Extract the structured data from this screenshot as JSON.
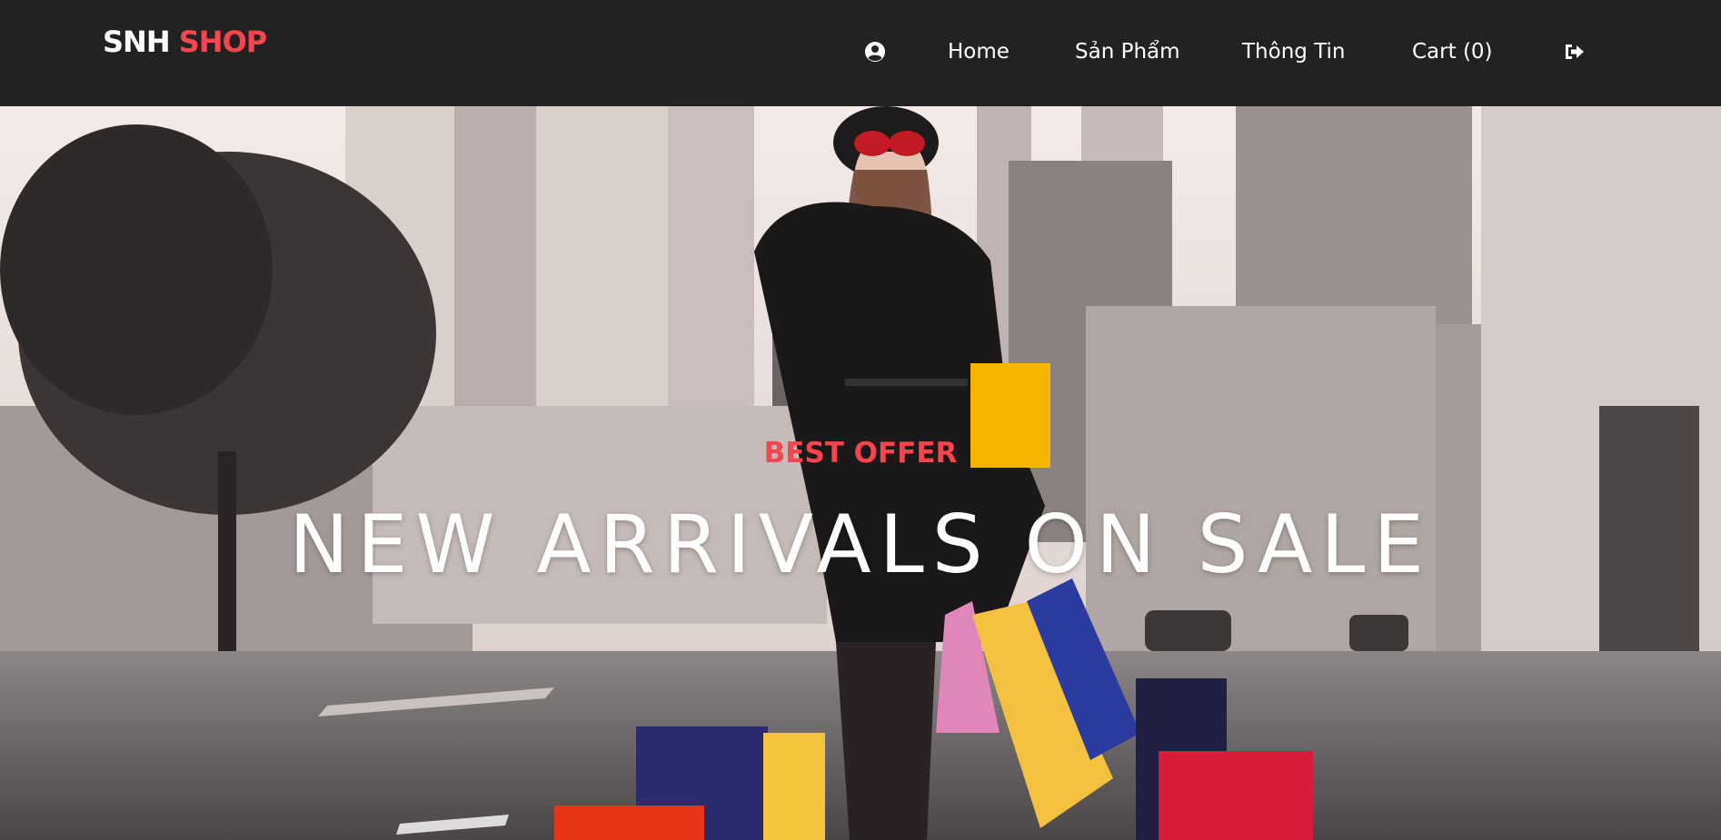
{
  "brand": {
    "part1": "SNH",
    "part2": "SHOP"
  },
  "nav": {
    "user_icon": "user-circle-icon",
    "home": "Home",
    "products": "Sản Phẩm",
    "info": "Thông Tin",
    "cart": "Cart (0)",
    "logout_icon": "sign-out-icon"
  },
  "hero": {
    "tag": "BEST OFFER",
    "headline": "NEW ARRIVALS ON SALE"
  },
  "colors": {
    "navbar_bg": "#222222",
    "accent": "#f7444e",
    "text": "#ffffff"
  }
}
